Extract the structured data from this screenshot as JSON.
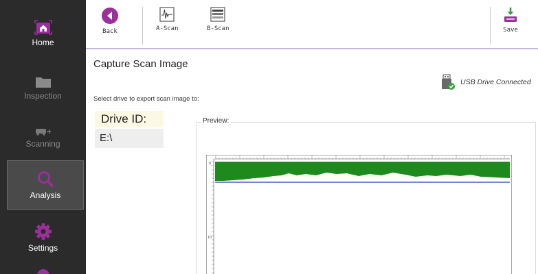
{
  "sidebar": {
    "items": [
      {
        "label": "Home",
        "icon": "home-icon",
        "state": "enabled"
      },
      {
        "label": "Inspection",
        "icon": "folder-icon",
        "state": "disabled"
      },
      {
        "label": "Scanning",
        "icon": "scanner-icon",
        "state": "disabled"
      },
      {
        "label": "Analysis",
        "icon": "magnifier-icon",
        "state": "selected"
      },
      {
        "label": "Settings",
        "icon": "gear-icon",
        "state": "enabled"
      }
    ]
  },
  "toolbar": {
    "back_label": "Back",
    "ascan_label": "A-Scan",
    "bscan_label": "B-Scan",
    "save_label": "Save"
  },
  "main": {
    "title": "Capture Scan Image",
    "usb_status": "USB Drive Connected",
    "instruction": "Select drive to export scan image to:",
    "drive_header": "Drive ID:",
    "drives": [
      "E:\\"
    ],
    "preview_label": "Preview:"
  },
  "colors": {
    "accent": "#9b2f9b",
    "sidebar_bg": "#2b2b2b",
    "scan_fill": "#1e8a1e",
    "scan_line": "#4a5fd0",
    "toolbar_divider": "#c7b7dd"
  }
}
